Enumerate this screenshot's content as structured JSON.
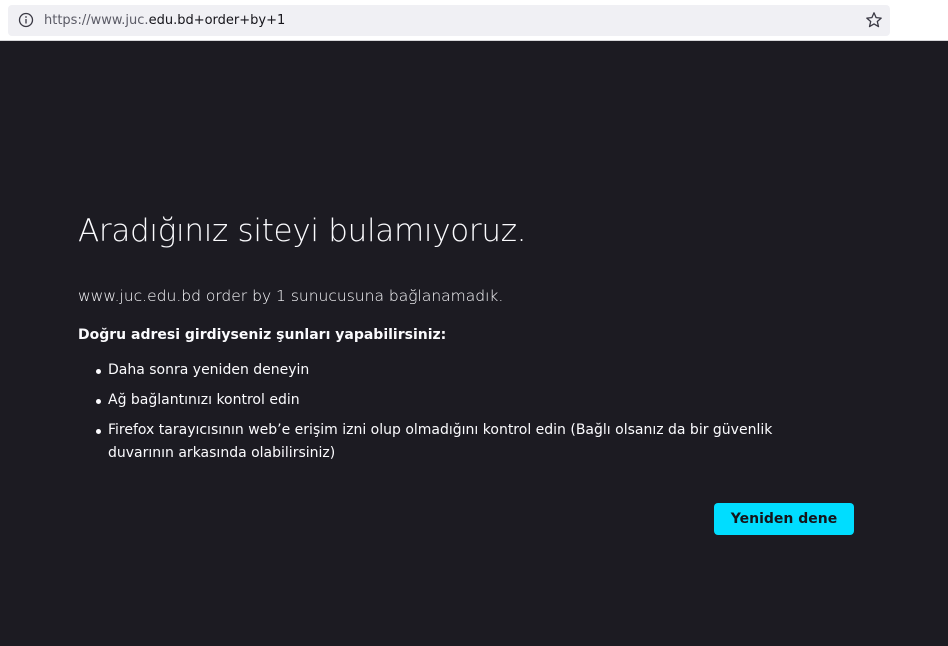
{
  "browser": {
    "url_prefix": "https://www.juc.",
    "url_main": "edu.bd+order+by+1",
    "icons": {
      "site_info": "info-icon",
      "bookmark": "star-icon"
    }
  },
  "error_page": {
    "title": "Aradığınız siteyi bulamıyoruz.",
    "short_description": "www.juc.edu.bd order by 1 sunucusuna bağlanamadık.",
    "advice_heading": "Doğru adresi girdiyseniz şunları yapabilirsiniz:",
    "advice_items": [
      "Daha sonra yeniden deneyin",
      "Ağ bağlantınızı kontrol edin",
      "Firefox tarayıcısının web’e erişim izni olup olmadığını kontrol edin (Bağlı olsanız da bir güvenlik duvarının arkasında olabilirsiniz)"
    ],
    "try_again_label": "Yeniden dene"
  },
  "colors": {
    "page_background": "#1c1b22",
    "accent_button": "#00ddff",
    "text": "#fbfbfe"
  }
}
